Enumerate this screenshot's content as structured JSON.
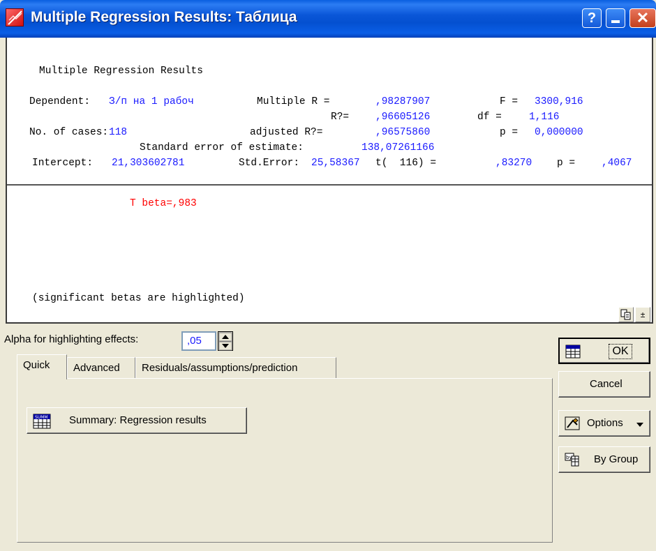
{
  "window": {
    "title": "Multiple Regression Results: Таблица",
    "help_glyph": "?",
    "close_glyph": "✕"
  },
  "report": {
    "heading": "Multiple Regression Results",
    "dependent_label": "Dependent:",
    "dependent_value": "З/п на 1 рабоч",
    "multiple_r_label": "Multiple R =",
    "multiple_r_value": ",98287907",
    "f_label": "F =",
    "f_value": "3300,916",
    "r2_label": "R?=",
    "r2_value": ",96605126",
    "df_label": "df =",
    "df_value": "1,116",
    "cases_label": "No. of cases:",
    "cases_value": "118",
    "adj_r2_label": "adjusted R?=",
    "adj_r2_value": ",96575860",
    "p_label": "p =",
    "p_value": "0,000000",
    "se_label": "Standard error of estimate:",
    "se_value": "138,07261166",
    "intercept_label": "Intercept:",
    "intercept_value": "21,303602781",
    "stderr_label": "Std.Error:",
    "stderr_value": "25,58367",
    "t_label": "t(  116) =",
    "t_value": ",83270",
    "p2_label": "p =",
    "p2_value": ",4067",
    "beta_line": "T beta=,983",
    "footnote": "(significant betas are highlighted)"
  },
  "controls": {
    "alpha_label": "Alpha for highlighting effects:",
    "alpha_value": ",05",
    "tabs": [
      "Quick",
      "Advanced",
      "Residuals/assumptions/prediction"
    ],
    "summary_button": "Summary:  Regression results",
    "ok": "OK",
    "cancel": "Cancel",
    "options": "Options",
    "by_group": "By Group"
  },
  "colors": {
    "value_blue": "#1a1aff",
    "highlight_red": "#ff0000",
    "titlebar_blue": "#0a56d8"
  }
}
